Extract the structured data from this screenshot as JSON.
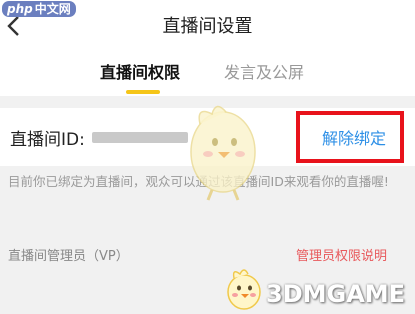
{
  "watermark_top": {
    "php": "php",
    "cn": "中文网"
  },
  "header": {
    "title": "直播间设置",
    "back_icon": "chevron-left-icon"
  },
  "tabs": [
    {
      "label": "直播间权限",
      "active": true
    },
    {
      "label": "发言及公屏",
      "active": false
    }
  ],
  "room": {
    "id_label": "直播间ID:",
    "unbind_label": "解除绑定"
  },
  "description": "目前你已绑定为直播间，观众可以通过该直播间ID来观看你的直播喔!",
  "vp": {
    "label": "直播间管理员（VP）",
    "link": "管理员权限说明"
  },
  "watermark_bottom": "3DMGAME",
  "colors": {
    "accent_yellow": "#f5c518",
    "link_blue": "#2d8fe6",
    "highlight_red": "#e8121b",
    "link_red": "#e8595c"
  }
}
